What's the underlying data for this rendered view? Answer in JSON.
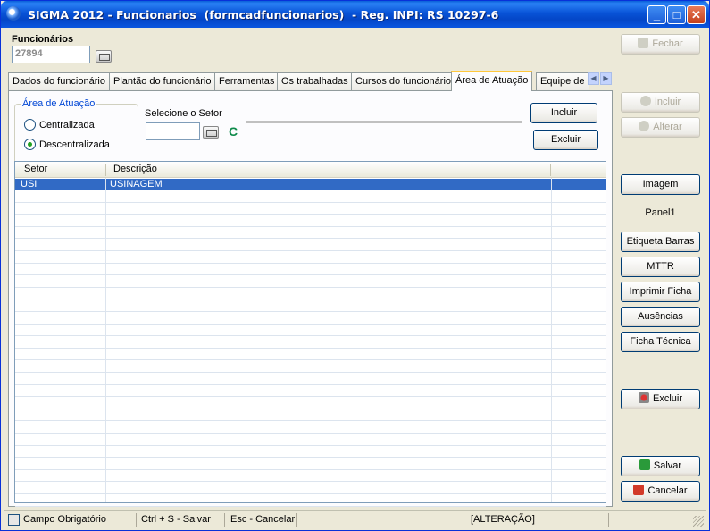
{
  "window": {
    "title": "SIGMA 2012 - Funcionarios  (formcadfuncionarios)  - Reg. INPI: RS 10297-6"
  },
  "header": {
    "section_label": "Funcionários",
    "id_value": "27894"
  },
  "tabs": [
    {
      "label": "Dados do funcionário"
    },
    {
      "label": "Plantão do funcionário"
    },
    {
      "label": "Ferramentas"
    },
    {
      "label": "Os trabalhadas"
    },
    {
      "label": "Cursos do funcionário"
    },
    {
      "label": "Área de Atuação"
    },
    {
      "label": "Equipe de"
    }
  ],
  "area_atuacao": {
    "group_title": "Área de Atuação",
    "option_centralizada": "Centralizada",
    "option_descentralizada": "Descentralizada",
    "selected": "Descentralizada",
    "setor_label": "Selecione o Setor",
    "setor_code_value": "",
    "setor_shortcut": "C",
    "incluir_label": "Incluir",
    "excluir_label": "Excluir"
  },
  "grid": {
    "columns": [
      "Setor",
      "Descrição"
    ],
    "rows": [
      {
        "setor": "USI",
        "descricao": "USINAGEM",
        "selected": true
      }
    ]
  },
  "sidebar": {
    "fechar": "Fechar",
    "incluir": "Incluir",
    "alterar": "Alterar",
    "imagem": "Imagem",
    "panel_label": "Panel1",
    "etiqueta": "Etiqueta Barras",
    "mttr": "MTTR",
    "imprimir": "Imprimir Ficha",
    "ausencias": "Ausências",
    "ficha_tecnica": "Ficha Técnica",
    "excluir": "Excluir",
    "salvar": "Salvar",
    "cancelar": "Cancelar"
  },
  "statusbar": {
    "required": "Campo Obrigatório",
    "save_hint": "Ctrl + S - Salvar",
    "cancel_hint": "Esc - Cancelar",
    "mode": "[ALTERAÇÃO]"
  },
  "colors": {
    "selection": "#316ac5",
    "title_blue": "#0853d7",
    "group_title": "#0046d5"
  }
}
